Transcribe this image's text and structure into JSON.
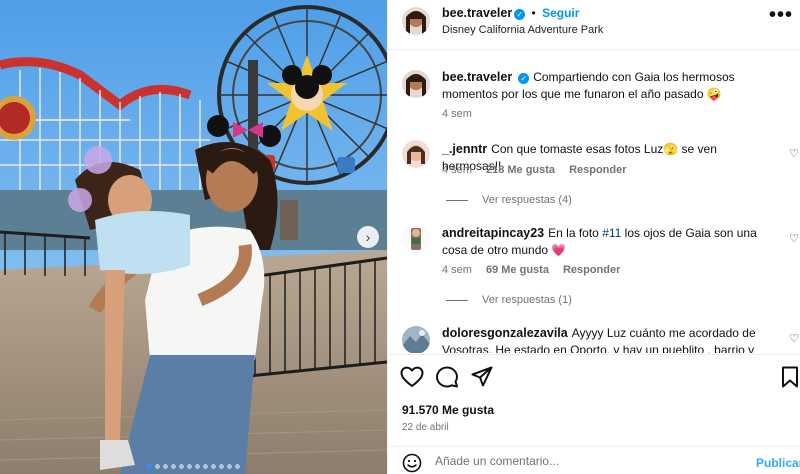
{
  "post": {
    "username": "bee.traveler",
    "follow_label": "Seguir",
    "location": "Disney California Adventure Park",
    "more_label": "•••"
  },
  "caption": {
    "username": "bee.traveler",
    "text": "Compartiendo con Gaia los hermosos momentos por los que me funaron el año pasado 🤪",
    "time": "4 sem"
  },
  "comments": [
    {
      "username": "_.jenntr",
      "text": "Con que tomaste esas fotos Luz🫣 se ven hermosas!!",
      "time": "4 sem",
      "likes": "218 Me gusta",
      "reply_label": "Responder",
      "view_replies": "Ver respuestas (4)"
    },
    {
      "username": "andreitapincay23",
      "text_before": "En la foto",
      "hashtag": "#11",
      "text_after": "los ojos de Gaia son una cosa de otro mundo 💗",
      "time": "4 sem",
      "likes": "69 Me gusta",
      "reply_label": "Responder",
      "view_replies": "Ver respuestas (1)"
    },
    {
      "username": "doloresgonzalezavila",
      "text": "Ayyyy Luz cuánto me acordado de Vosotras. He estado en Oporto, y hay un pueblito , barrio y"
    }
  ],
  "stats": {
    "likes": "91.570 Me gusta",
    "date": "22 de abril"
  },
  "add_comment": {
    "placeholder": "Añade un comentario...",
    "publish_label": "Publicar"
  },
  "icons": {
    "heart": "heart-icon",
    "comment": "comment-icon",
    "share": "share-icon",
    "save": "bookmark-icon",
    "emoji": "emoji-icon",
    "next": "chevron-right-icon"
  },
  "carousel": {
    "total_slides": 12,
    "active_slide": 1
  },
  "colors": {
    "accent": "#0095f6",
    "meta": "#737373",
    "hashtag": "#00376b"
  }
}
